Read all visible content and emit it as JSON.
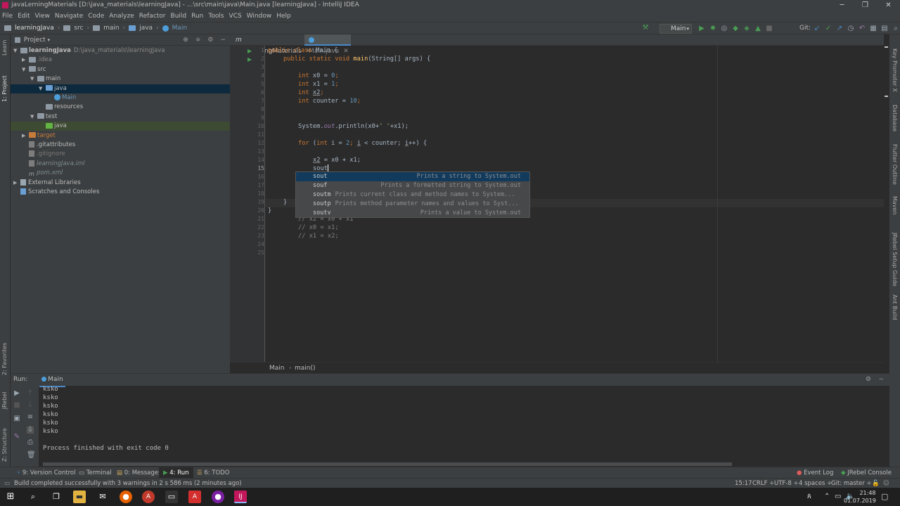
{
  "window": {
    "title": "javaLerningMaterials [D:\\java_materials\\learningJava] - ...\\src\\main\\java\\Main.java [learningJava] - IntelliJ IDEA",
    "controls": [
      "─",
      "❐",
      "✕"
    ]
  },
  "menu": [
    "File",
    "Edit",
    "View",
    "Navigate",
    "Code",
    "Analyze",
    "Refactor",
    "Build",
    "Run",
    "Tools",
    "VCS",
    "Window",
    "Help"
  ],
  "breadcrumbs": [
    "learningJava",
    "src",
    "main",
    "java",
    "Main"
  ],
  "run_config": "Main",
  "git_label": "Git:",
  "left_stripe": [
    "1: Project",
    "Learn",
    "2: Favorites",
    "JRebel",
    "Z: Structure"
  ],
  "right_stripe": [
    "Key Promoter X",
    "Database",
    "Flutter Outline",
    "Maven",
    "JRebel Setup Guide",
    "Ant Build"
  ],
  "project": {
    "header": "Project",
    "tree": [
      {
        "label": "learningJava",
        "suffix": "D:\\java_materials\\learningJava",
        "depth": 0,
        "arrow": "▼",
        "icon": "folder"
      },
      {
        "label": ".idea",
        "depth": 1,
        "arrow": "▶",
        "icon": "folder"
      },
      {
        "label": "src",
        "depth": 1,
        "arrow": "▼",
        "icon": "folder"
      },
      {
        "label": "main",
        "depth": 2,
        "arrow": "▼",
        "icon": "folder"
      },
      {
        "label": "java",
        "depth": 3,
        "arrow": "▼",
        "icon": "folder-blue"
      },
      {
        "label": "Main",
        "depth": 4,
        "arrow": "",
        "icon": "class"
      },
      {
        "label": "resources",
        "depth": 3,
        "arrow": "",
        "icon": "folder"
      },
      {
        "label": "test",
        "depth": 2,
        "arrow": "▼",
        "icon": "folder"
      },
      {
        "label": "java",
        "depth": 3,
        "arrow": "",
        "icon": "folder-green"
      },
      {
        "label": "target",
        "depth": 1,
        "arrow": "▶",
        "icon": "folder-orange"
      },
      {
        "label": ".gitattributes",
        "depth": 1,
        "arrow": "",
        "icon": "file"
      },
      {
        "label": ".gitignore",
        "depth": 1,
        "arrow": "",
        "icon": "file"
      },
      {
        "label": "learningJava.iml",
        "depth": 1,
        "arrow": "",
        "icon": "file"
      },
      {
        "label": "pom.xml",
        "depth": 1,
        "arrow": "",
        "icon": "maven"
      },
      {
        "label": "External Libraries",
        "depth": 0,
        "arrow": "▶",
        "icon": "lib"
      },
      {
        "label": "Scratches and Consoles",
        "depth": 0,
        "arrow": "",
        "icon": "scratch"
      }
    ]
  },
  "tabs": [
    {
      "label": "javaLerningMaterials",
      "active": false
    },
    {
      "label": "Main.java",
      "active": true
    }
  ],
  "code_lines": [
    "1",
    "2",
    "3",
    "4",
    "5",
    "6",
    "7",
    "8",
    "9",
    "10",
    "11",
    "12",
    "13",
    "14",
    "15",
    "16",
    "17",
    "18",
    "19",
    "20",
    "21",
    "22",
    "23",
    "24",
    "25"
  ],
  "code": {
    "l1a": "public class ",
    "l1b": "Main {",
    "l2a": "public static void ",
    "l2b": "main",
    "l2c": "(String[] args) {",
    "l4a": "int ",
    "l4b": "x0 = ",
    "l4c": "0",
    "l4d": ";",
    "l5a": "int ",
    "l5b": "x1 = ",
    "l5c": "1",
    "l5d": ";",
    "l6a": "int ",
    "l6b": "x2",
    "l6c": ";",
    "l7a": "int ",
    "l7b": "counter = ",
    "l7c": "10",
    "l7d": ";",
    "l10a": "System.",
    "l10b": "out",
    "l10c": ".println(x0+",
    "l10d": "\" \"",
    "l10e": "+x1);",
    "l12a": "for ",
    "l12b": "(",
    "l12c": "int ",
    "l12d": "i = ",
    "l12e": "2",
    "l12f": "; ",
    "l12g": "i",
    "l12h": " < counter; ",
    "l12i": "i",
    "l12j": "++) {",
    "l14a": "x2",
    "l14b": " = x0 + x1;",
    "l15": "sout",
    "l19": "}",
    "l20": "}",
    "l21": "// x2 = x0 + x1",
    "l22": "// x0 = x1;",
    "l23": "// x1 = x2;"
  },
  "completion": [
    {
      "key": "sout",
      "desc": "",
      "right": "Prints a string to System.out"
    },
    {
      "key": "souf",
      "desc": "",
      "right": "Prints a formatted string to System.out"
    },
    {
      "key": "soutm",
      "desc": "Prints current class and method names to System...",
      "right": ""
    },
    {
      "key": "soutp",
      "desc": "Prints method parameter names and values to Syst...",
      "right": ""
    },
    {
      "key": "soutv",
      "desc": "",
      "right": "Prints a value to System.out"
    }
  ],
  "editor_breadcrumb": [
    "Main",
    "main()"
  ],
  "run": {
    "label": "Run:",
    "config": "Main",
    "output": [
      "ksko",
      "ksko",
      "ksko",
      "ksko",
      "ksko",
      "ksko"
    ],
    "finished": "Process finished with exit code 0"
  },
  "bottom_tabs": [
    "9: Version Control",
    "Terminal",
    "0: Messages",
    "4: Run",
    "6: TODO"
  ],
  "event_log": "Event Log",
  "jrebel_console": "JRebel Console",
  "status": {
    "message": "Build completed successfully with 3 warnings in 2 s 586 ms (2 minutes ago)",
    "position": "15:17",
    "line_sep": "CRLF ÷",
    "encoding": "UTF-8 ÷",
    "indent": "4 spaces ÷",
    "branch": "Git: master ÷"
  },
  "taskbar": {
    "time": "21:48",
    "date": "01.07.2019"
  },
  "colors": {
    "accent": "#4a88c7",
    "keyword": "#cc7832",
    "number": "#6897bb",
    "string": "#6a8759",
    "method": "#ffc66d"
  }
}
